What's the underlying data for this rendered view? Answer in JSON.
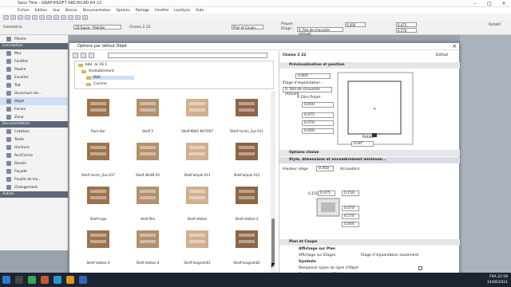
{
  "window": {
    "title": "Sans Titre - GRAPHISOFT ARCHICAD 64 22"
  },
  "menu": [
    "Fichier",
    "Edition",
    "Vue",
    "Dessin",
    "Documentation",
    "Options",
    "Partage",
    "Fenêtre",
    "LiveSync",
    "Aide"
  ],
  "toolbar": {
    "layer_label": "2D Equip - Mobilier",
    "chaise_label": "Chaise 2 22",
    "plan_coupe": "Plan et Coupe...",
    "propre": "Propre",
    "etage": "Étage :",
    "etage_val": "0. Rez-de-chaussée (Actuel)",
    "v1": "0,000",
    "v2": "0,475",
    "v3": "0,570",
    "rotate": "Rotatif"
  },
  "left": {
    "sections": [
      "Conception",
      "Documentation",
      "Autres"
    ],
    "design": [
      "Pièche",
      "Mur",
      "Fenêtre",
      "Poutre",
      "Escalier",
      "Toit",
      "Ouverture de...",
      "Objet",
      "Forme",
      "Zone"
    ],
    "doc": [
      "Cotation",
      "Texte",
      "Hachure",
      "Arc/Cercle",
      "Dessin",
      "Façade",
      "Feuille de tra...",
      "Changement"
    ]
  },
  "dialog": {
    "title": "Options par défaut Objet",
    "tree": [
      "bibl. ar 16-1",
      "Améublement",
      "Bâti",
      "Cuisine"
    ]
  },
  "objects": [
    {
      "name": "Rack Bar"
    },
    {
      "name": "Shelf 2"
    },
    {
      "name": "Shelf KN42 NO7007"
    },
    {
      "name": "Shelf mcmn_5oc-011"
    },
    {
      "name": "Shelf mcmn_5oc-017"
    },
    {
      "name": "Shelf-36s69 03"
    },
    {
      "name": "Shelf-ample A11"
    },
    {
      "name": "Shelf-ample A12"
    },
    {
      "name": "Shelf-ergo"
    },
    {
      "name": "shelf-film"
    },
    {
      "name": "Shelf-station"
    },
    {
      "name": "Shelf-station-2"
    },
    {
      "name": "Shelf-station-3"
    },
    {
      "name": "Shelf-station-4"
    },
    {
      "name": "Shelf-tangram01"
    },
    {
      "name": "Shelf-tangram02"
    }
  ],
  "props": {
    "header": "Chaise 2 22",
    "default": "Défaut",
    "sec1": "Prévisualisation et position",
    "v_top": "0,000",
    "etage_label": "Étage d'implantation :",
    "etage_val": "0. Rez-de-chaussée (Actuel)",
    "zero": "À Zéro Projet",
    "v_a": "0,000",
    "v_b": "0,475",
    "v_c": "0,570",
    "v_d": "0,000",
    "angle": "0,00°",
    "rot": "Rotatif",
    "sec2": "Options chaise",
    "sec3": "Style, dimensions et encombrement minimum...",
    "hauteur_label": "Hauteur siège",
    "hauteur_val": "0,450",
    "accoudoirs": "Accoudoirs",
    "d1": "0,150",
    "d2": "0,475",
    "d3": "0,150",
    "d4": "0,070",
    "d5": "0,570",
    "d6": "0,000",
    "sec4": "Plan et Coupe",
    "sub1": "Affichage sur Plan",
    "aff_label": "Affichage sur Étages",
    "aff_val": "Étage d'implantation seulement",
    "sub2": "Symbole",
    "rep1": "Remplacer types de ligne d'Objet",
    "rep2": "Remplacer stylos d'Objet"
  },
  "taskbar": {
    "time": "22:58",
    "date": "14/06/2021",
    "lang": "FRA"
  }
}
